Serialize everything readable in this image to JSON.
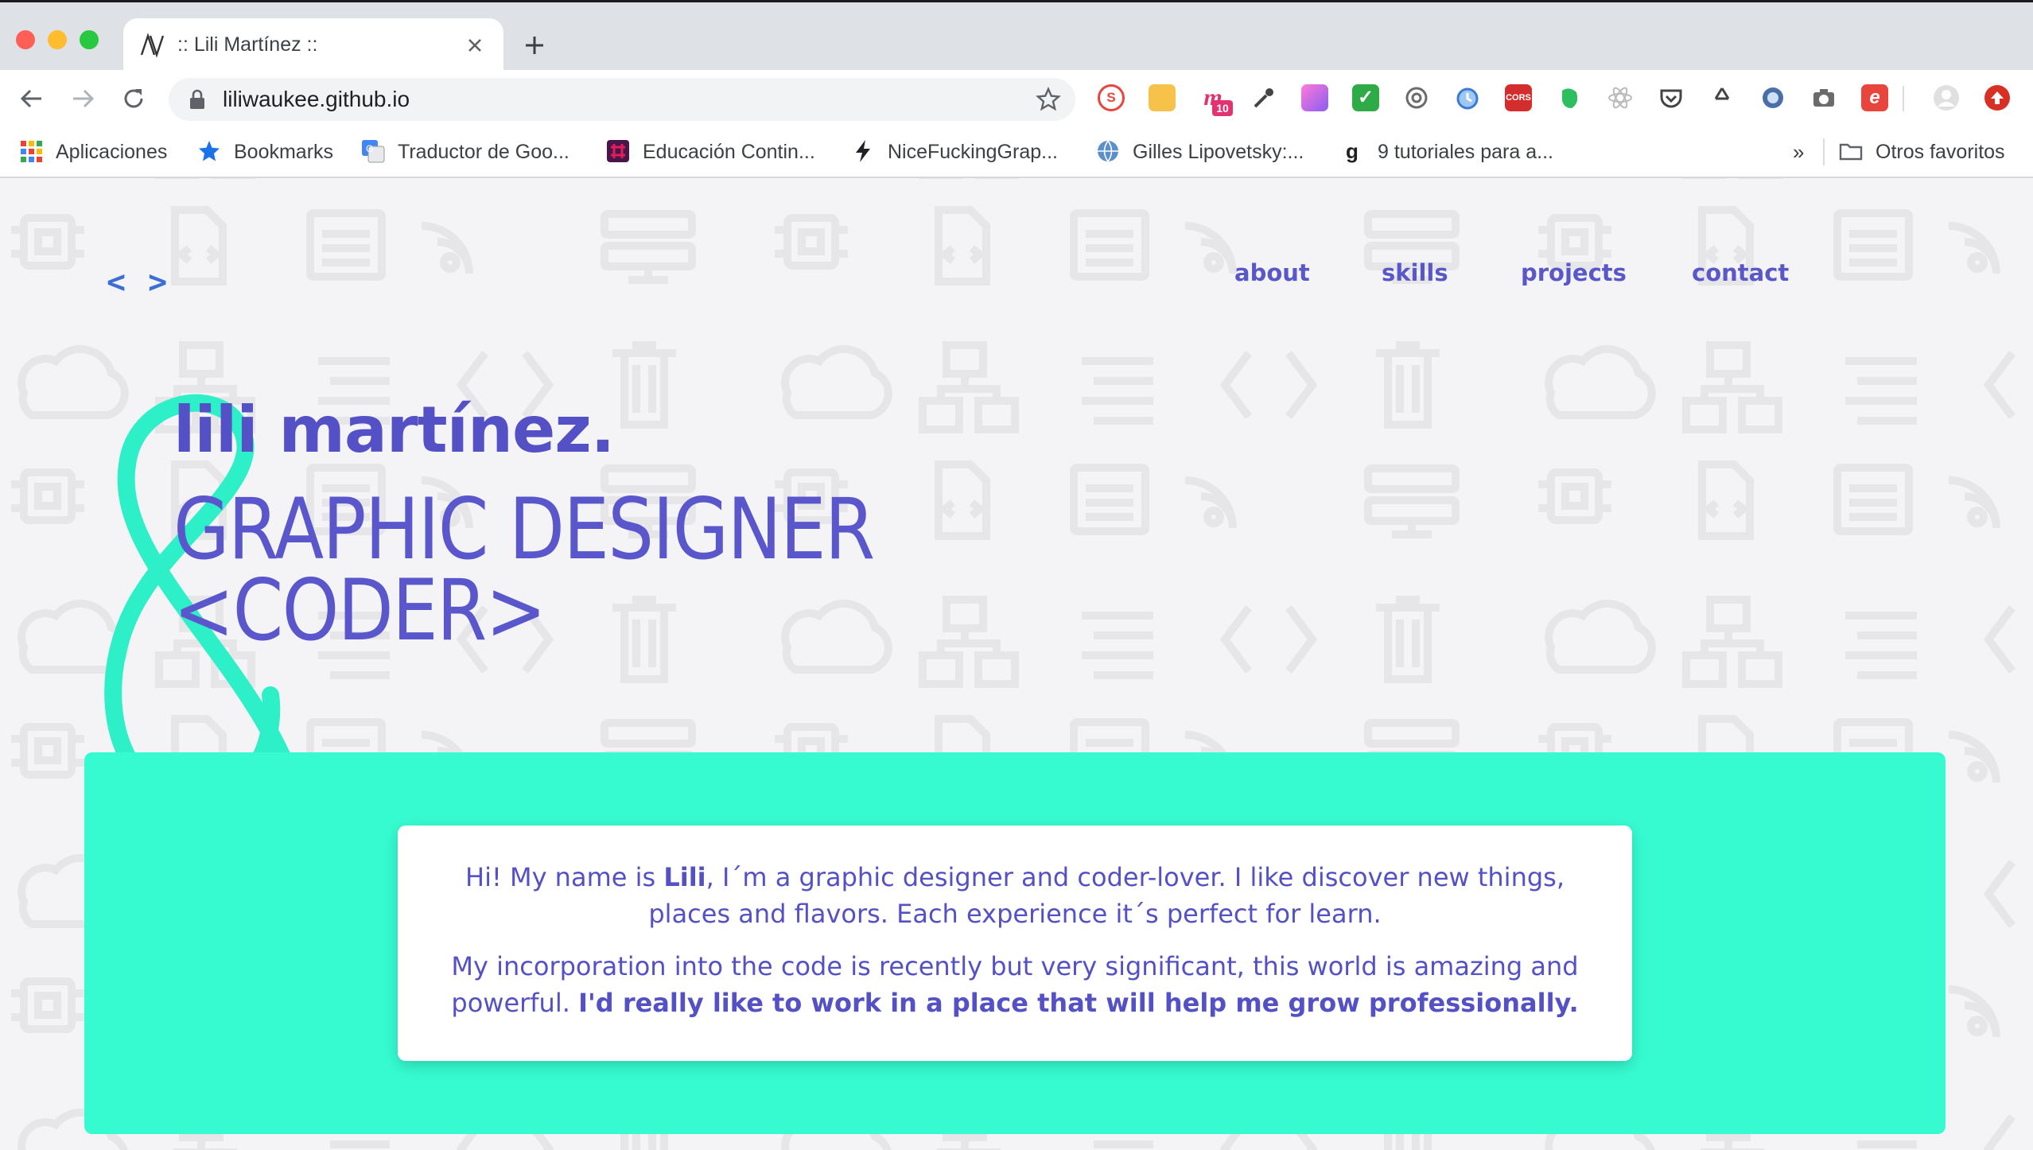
{
  "browser": {
    "tab_title": ":: Lili Martínez ::",
    "url": "liliwaukee.github.io",
    "bookmarks": [
      {
        "label": "Aplicaciones",
        "icon": "apps-grid-icon"
      },
      {
        "label": "Bookmarks",
        "icon": "star-icon"
      },
      {
        "label": "Traductor de Goo...",
        "icon": "google-translate-icon"
      },
      {
        "label": "Educación Contin...",
        "icon": "slack-icon"
      },
      {
        "label": "NiceFuckingGrap...",
        "icon": "lightning-icon"
      },
      {
        "label": "Gilles Lipovetsky:...",
        "icon": "globe-icon"
      },
      {
        "label": "9 tutoriales para a...",
        "icon": "g-letter-icon"
      }
    ],
    "more_bookmarks": "»",
    "other_bookmarks": "Otros favoritos",
    "extension_badge": "10",
    "extension_cors": "CORS",
    "colors": {
      "tabbar": "#dee1e6",
      "close": "#ff5f57",
      "minimize": "#febc2e",
      "maximize": "#28c840"
    }
  },
  "site": {
    "logo": "< >",
    "nav": [
      "about",
      "skills",
      "projects",
      "contact"
    ],
    "name": "lili martínez.",
    "role_line1": "GRAPHIC DESIGNER",
    "role_line2": "<CODER>",
    "about": {
      "p1_before": "Hi! My name is ",
      "p1_bold": "Lili",
      "p1_after": ", I´m a graphic designer and coder-lover. I like discover new things, places and flavors. Each experience it´s perfect for learn.",
      "p2_before": "My incorporation into the code is recently but very significant, this world is amazing and powerful. ",
      "p2_bold": "I'd really like to work in a place that will help me grow professionally."
    },
    "colors": {
      "accent": "#5450c5",
      "logo": "#3b6fd4",
      "band": "#36fbd1",
      "ampersand": "#2ef0c8",
      "background": "#f4f4f6"
    }
  }
}
